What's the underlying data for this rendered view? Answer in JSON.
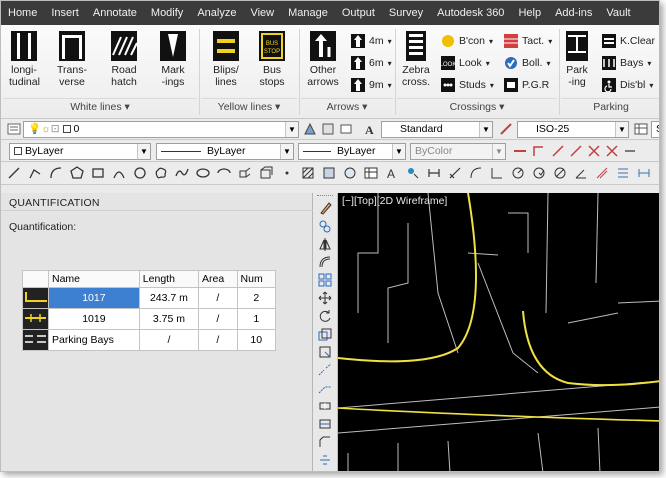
{
  "menu": {
    "items": [
      "Home",
      "Insert",
      "Annotate",
      "Modify",
      "Analyze",
      "View",
      "Manage",
      "Output",
      "Survey",
      "Autodesk 360",
      "Help",
      "Add-ins",
      "Vault"
    ]
  },
  "ribbon": {
    "white_lines": {
      "longitudinal": "longi-\ntudinal",
      "transverse": "Trans-\nverse",
      "road_hatch": "Road\nhatch",
      "markings": "Mark\n-ings",
      "group_label": "White lines ▾"
    },
    "yellow_lines": {
      "blips": "Blips/\nlines",
      "bus_stops": "Bus\nstops",
      "group_label": "Yellow lines ▾"
    },
    "arrows": {
      "other": "Other\narrows",
      "4m": "4m",
      "6m": "6m",
      "9m": "9m",
      "group_label": "Arrows ▾"
    },
    "crossings": {
      "zebra": "Zebra\ncross.",
      "bcon": "B'con",
      "look": "Look",
      "studs": "Studs",
      "tact": "Tact.",
      "boll": "Boll.",
      "pgr": "P.G.R",
      "group_label": "Crossings ▾"
    },
    "parking": {
      "parking": "Park\n-ing",
      "kclear": "K.Clear",
      "bays": "Bays",
      "disbl": "Dis'bl",
      "group_label": "Parking"
    }
  },
  "toolbar1": {
    "layer": "0",
    "text_style": "Standard",
    "dim_style": "ISO-25",
    "table_style": "Sta"
  },
  "toolbar2": {
    "color": "ByLayer",
    "linetype": "ByLayer",
    "lineweight": "ByLayer",
    "plotstyle": "ByColor"
  },
  "panel": {
    "title": "QUANTIFICATION",
    "subtitle": "Quantification:",
    "columns": [
      "Name",
      "Length",
      "Area",
      "Num"
    ],
    "rows": [
      {
        "name": "1017",
        "length": "243.7 m",
        "area": "/",
        "num": "2"
      },
      {
        "name": "1019",
        "length": "3.75 m",
        "area": "/",
        "num": "1"
      },
      {
        "name": "Parking Bays",
        "length": "/",
        "area": "/",
        "num": "10"
      }
    ]
  },
  "viewport": {
    "label": "[−][Top][2D Wireframe]"
  },
  "colors": {
    "road_line": "#f0e040",
    "selection": "#3d7fd0",
    "viewport_bg": "#000000",
    "menubar": "#3b3b3b"
  }
}
